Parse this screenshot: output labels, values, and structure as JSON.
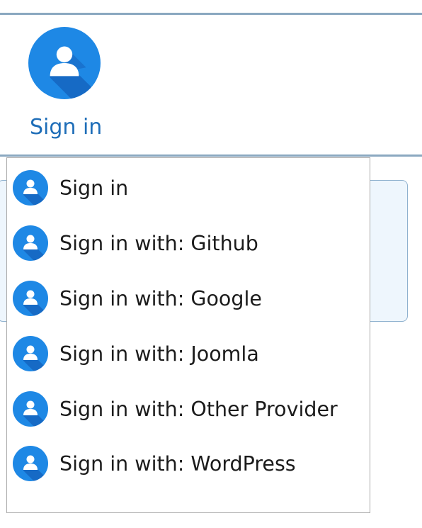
{
  "header": {
    "signin_label": "Sign in",
    "avatar_icon": "user-avatar-icon",
    "accent_color": "#1e88e5",
    "label_color": "#1f6eb8"
  },
  "dropdown": {
    "items": [
      {
        "label": "Sign in",
        "icon": "user-avatar-icon"
      },
      {
        "label": "Sign in with: Github",
        "icon": "user-avatar-icon"
      },
      {
        "label": "Sign in with: Google",
        "icon": "user-avatar-icon"
      },
      {
        "label": "Sign in with: Joomla",
        "icon": "user-avatar-icon"
      },
      {
        "label": "Sign in with: Other Provider",
        "icon": "user-avatar-icon"
      },
      {
        "label": "Sign in with: WordPress",
        "icon": "user-avatar-icon"
      }
    ]
  }
}
